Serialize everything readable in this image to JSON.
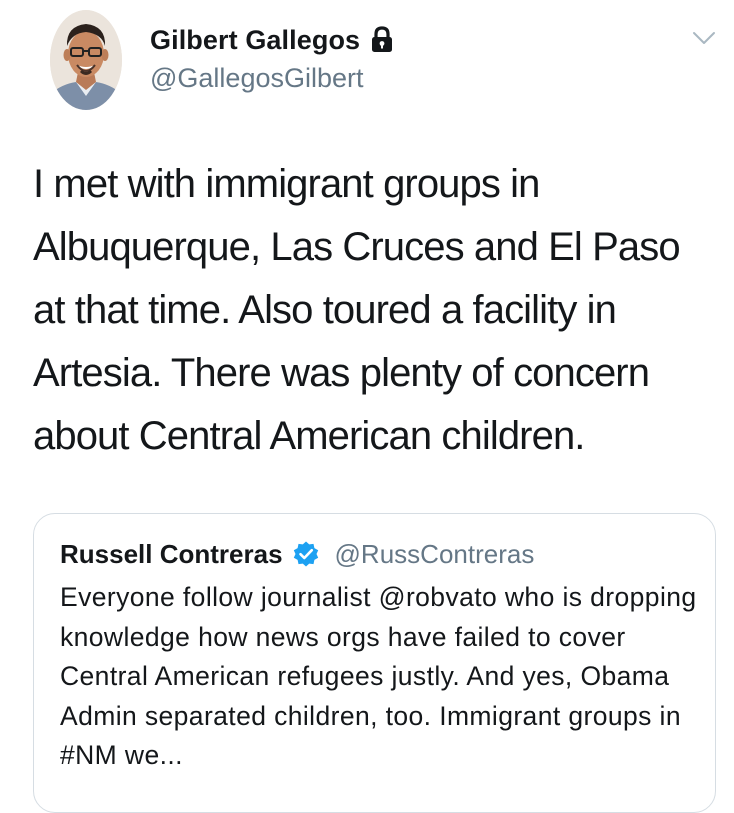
{
  "tweet": {
    "author": {
      "display_name": "Gilbert Gallegos",
      "handle": "@GallegosGilbert",
      "avatar_icon": "person-photo-avatar",
      "protected_icon": "lock-icon"
    },
    "menu_icon": "chevron-down-icon",
    "text": "I met with immigrant groups in Albuquerque, Las Cruces and El Paso at that time. Also toured a facility in Artesia. There was plenty of concern about Central American children."
  },
  "quoted_tweet": {
    "display_name": "Russell Contreras",
    "verified_icon": "verified-badge-icon",
    "handle": "@RussContreras",
    "text": "Everyone follow journalist @robvato who is dropping knowledge how news orgs have failed to cover Central American refugees justly. And yes, Obama Admin separated children, too. Immigrant groups in #NM we..."
  },
  "colors": {
    "text_primary": "#14171a",
    "text_secondary": "#657786",
    "border": "#d6dde3",
    "verified_blue": "#1da1f2"
  }
}
